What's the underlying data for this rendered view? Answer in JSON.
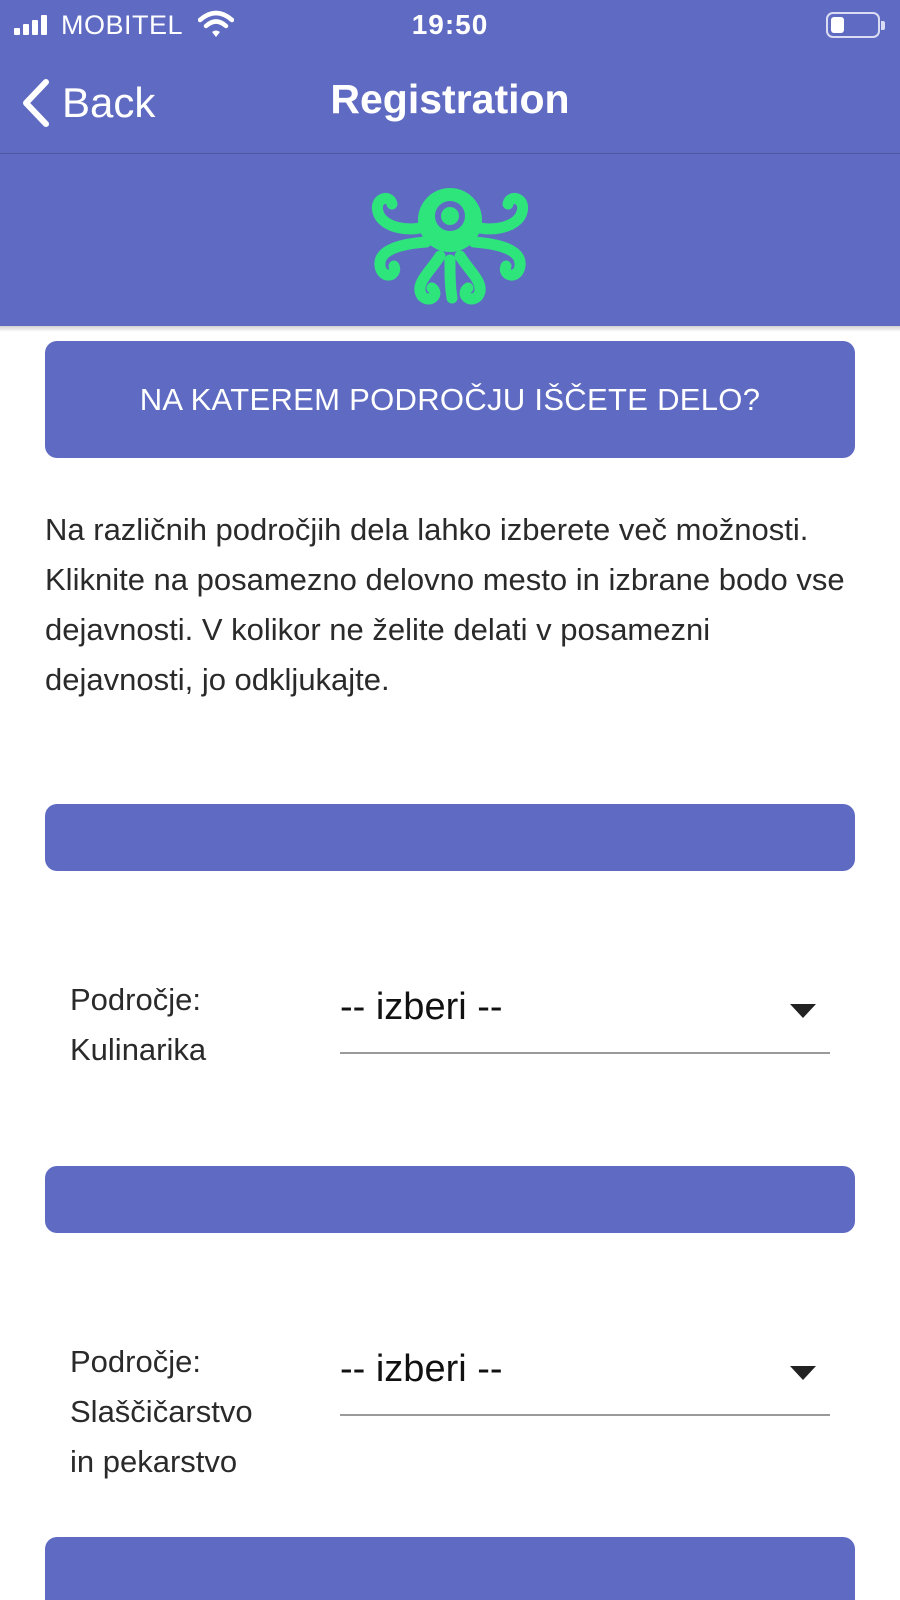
{
  "status_bar": {
    "carrier": "MOBITEL",
    "time": "19:50"
  },
  "nav": {
    "back_label": "Back",
    "title": "Registration"
  },
  "logo": {
    "icon": "octopus-logo",
    "color": "#2ee57c"
  },
  "question_banner": {
    "text": "NA KATEREM PODROČJU IŠČETE DELO?"
  },
  "instructions": {
    "text": "Na različnih področjih dela lahko izberete več možnosti. Kliknite na posamezno delovno mesto in izbrane bodo vse dejavnosti. V kolikor ne želite delati v posamezni dejavnosti, jo odkljukajte."
  },
  "fields": [
    {
      "label_line1": "Področje:",
      "label_line2": "Kulinarika",
      "select_value": "-- izberi --"
    },
    {
      "label_line1": "Področje:",
      "label_line2": "Slaščičarstvo",
      "label_line3": "in pekarstvo",
      "select_value": "-- izberi --"
    }
  ],
  "colors": {
    "primary": "#5f6bc2",
    "logo_green": "#2ee57c"
  }
}
